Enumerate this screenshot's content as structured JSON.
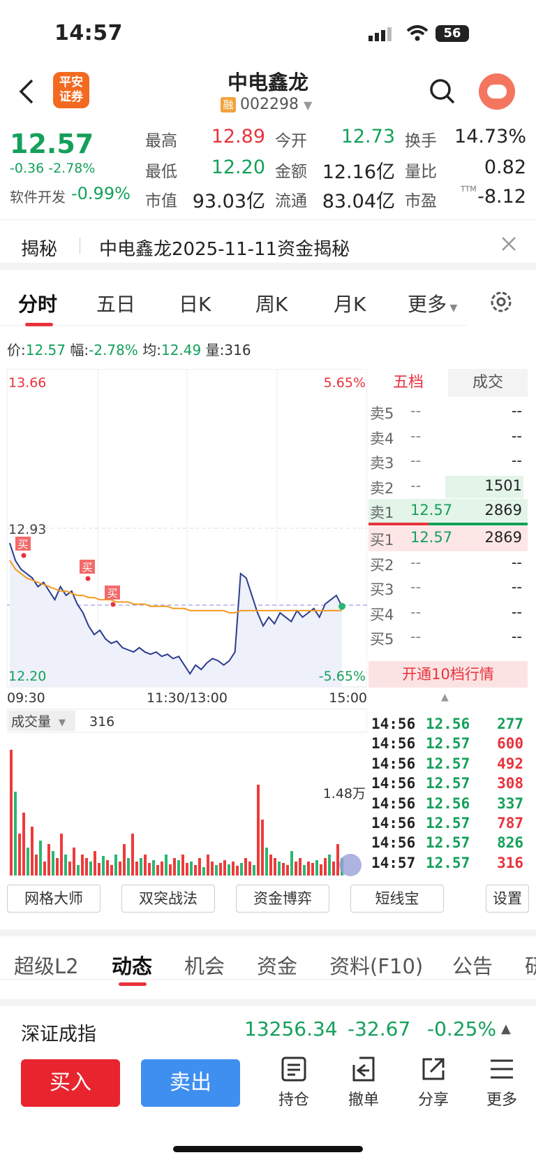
{
  "status": {
    "time": "14:57",
    "battery": "56"
  },
  "header": {
    "name": "中电鑫龙",
    "code": "002298",
    "margin_badge": "融",
    "broker_logo": "平安\n证券"
  },
  "quote": {
    "price": "12.57",
    "change": "-0.36",
    "pct": "-2.78%",
    "sector": "软件开发",
    "sector_pct": "-0.99%",
    "high_label": "最高",
    "high": "12.89",
    "low_label": "最低",
    "low": "12.20",
    "cap_label": "市值",
    "cap": "93.03亿",
    "open_label": "今开",
    "open": "12.73",
    "amount_label": "金额",
    "amount": "12.16亿",
    "float_label": "流通",
    "float": "83.04亿",
    "turnover_label": "换手",
    "turnover": "14.73%",
    "vol_ratio_label": "量比",
    "vol_ratio": "0.82",
    "pe_label": "市盈",
    "pe_sup": "TTM",
    "pe": "-8.12"
  },
  "reveal": {
    "label": "揭秘",
    "text": "中电鑫龙2025-11-11资金揭秘"
  },
  "tabs": [
    "分时",
    "五日",
    "日K",
    "周K",
    "月K",
    "更多"
  ],
  "info": {
    "price_label": "价:",
    "price": "12.57",
    "pct_label": "幅:",
    "pct": "-2.78%",
    "avg_label": "均:",
    "avg": "12.49",
    "vol_label": "量:",
    "vol": "316"
  },
  "chart_data": {
    "type": "line",
    "y_top": "13.66",
    "y_mid": "12.93",
    "y_bot": "12.20",
    "pct_top": "5.65%",
    "pct_bot": "-5.65%",
    "x_labels": [
      "09:30",
      "11:30/13:00",
      "15:00"
    ],
    "ylim": [
      12.2,
      13.66
    ],
    "price": [
      12.86,
      12.78,
      12.74,
      12.72,
      12.7,
      12.66,
      12.68,
      12.64,
      12.6,
      12.66,
      12.62,
      12.64,
      12.58,
      12.54,
      12.48,
      12.44,
      12.46,
      12.42,
      12.4,
      12.41,
      12.38,
      12.37,
      12.36,
      12.38,
      12.36,
      12.35,
      12.36,
      12.34,
      12.35,
      12.33,
      12.34,
      12.3,
      12.26,
      12.3,
      12.28,
      12.31,
      12.33,
      12.32,
      12.3,
      12.32,
      12.36,
      12.72,
      12.7,
      12.62,
      12.54,
      12.48,
      12.52,
      12.49,
      12.54,
      12.52,
      12.5,
      12.55,
      12.52,
      12.54,
      12.56,
      12.52,
      12.58,
      12.6,
      12.62,
      12.57
    ],
    "avg": [
      12.78,
      12.74,
      12.72,
      12.7,
      12.69,
      12.68,
      12.67,
      12.66,
      12.65,
      12.64,
      12.64,
      12.63,
      12.62,
      12.62,
      12.61,
      12.61,
      12.6,
      12.6,
      12.6,
      12.59,
      12.59,
      12.59,
      12.58,
      12.58,
      12.58,
      12.57,
      12.57,
      12.57,
      12.57,
      12.56,
      12.56,
      12.56,
      12.55,
      12.55,
      12.55,
      12.55,
      12.55,
      12.55,
      12.55,
      12.54,
      12.54,
      12.55,
      12.55,
      12.55,
      12.55,
      12.55,
      12.55,
      12.55,
      12.55,
      12.55,
      12.55,
      12.55,
      12.55,
      12.55,
      12.55,
      12.55,
      12.55,
      12.55,
      12.55,
      12.55
    ],
    "markers": [
      "买",
      "买",
      "买"
    ],
    "volume_label": "成交量",
    "volume_value": "316",
    "volume_max": "1.48万"
  },
  "book": {
    "tabs": [
      "五档",
      "成交"
    ],
    "asks": [
      {
        "label": "卖5",
        "price": "--",
        "vol": "--"
      },
      {
        "label": "卖4",
        "price": "--",
        "vol": "--"
      },
      {
        "label": "卖3",
        "price": "--",
        "vol": "--"
      },
      {
        "label": "卖2",
        "price": "--",
        "vol": "1501"
      },
      {
        "label": "卖1",
        "price": "12.57",
        "vol": "2869"
      }
    ],
    "bids": [
      {
        "label": "买1",
        "price": "12.57",
        "vol": "2869"
      },
      {
        "label": "买2",
        "price": "--",
        "vol": "--"
      },
      {
        "label": "买3",
        "price": "--",
        "vol": "--"
      },
      {
        "label": "买4",
        "price": "--",
        "vol": "--"
      },
      {
        "label": "买5",
        "price": "--",
        "vol": "--"
      }
    ],
    "open10": "开通10档行情"
  },
  "ticks": [
    {
      "t": "14:56",
      "p": "12.56",
      "v": "277",
      "c": "g"
    },
    {
      "t": "14:56",
      "p": "12.57",
      "v": "600",
      "c": "r"
    },
    {
      "t": "14:56",
      "p": "12.57",
      "v": "492",
      "c": "r"
    },
    {
      "t": "14:56",
      "p": "12.57",
      "v": "308",
      "c": "r"
    },
    {
      "t": "14:56",
      "p": "12.56",
      "v": "337",
      "c": "g"
    },
    {
      "t": "14:56",
      "p": "12.57",
      "v": "787",
      "c": "r"
    },
    {
      "t": "14:56",
      "p": "12.57",
      "v": "826",
      "c": "g"
    },
    {
      "t": "14:57",
      "p": "12.57",
      "v": "316",
      "c": "r"
    }
  ],
  "tools": [
    "网格大师",
    "双突战法",
    "资金博弈",
    "短线宝",
    "设置"
  ],
  "ftabs": [
    "超级L2",
    "动态",
    "机会",
    "资金",
    "资料(F10)",
    "公告",
    "研"
  ],
  "index": {
    "name": "深证成指",
    "value": "13256.34",
    "change": "-32.67",
    "pct": "-0.25%"
  },
  "actions": {
    "buy": "买入",
    "sell": "卖出",
    "hold": "持仓",
    "cancel": "撤单",
    "share": "分享",
    "more": "更多"
  }
}
